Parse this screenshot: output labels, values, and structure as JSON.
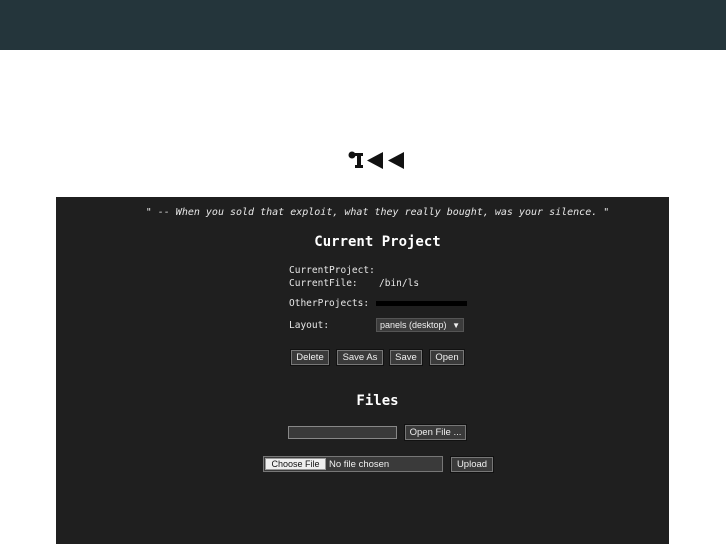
{
  "quote": "\" -- When you sold that exploit, what they really bought, was your silence. \"",
  "current_project": {
    "heading": "Current Project",
    "current_project_label": "CurrentProject:",
    "current_project_value": "",
    "current_file_label": "CurrentFile:",
    "current_file_value": "/bin/ls",
    "other_projects_label": "OtherProjects:",
    "layout_label": "Layout:",
    "layout_selected": "panels (desktop)",
    "buttons": {
      "delete": "Delete",
      "save_as": "Save As",
      "save": "Save",
      "open": "Open"
    }
  },
  "files": {
    "heading": "Files",
    "open_file_button": "Open File ...",
    "choose_file_button": "Choose File",
    "no_file_text": "No file chosen",
    "upload_button": "Upload"
  },
  "icons": {
    "logo": "r2-logo-icon",
    "select_arrow": "chevron-down-icon"
  },
  "colors": {
    "topbar": "#24353b",
    "panel": "#1f1f1f"
  }
}
